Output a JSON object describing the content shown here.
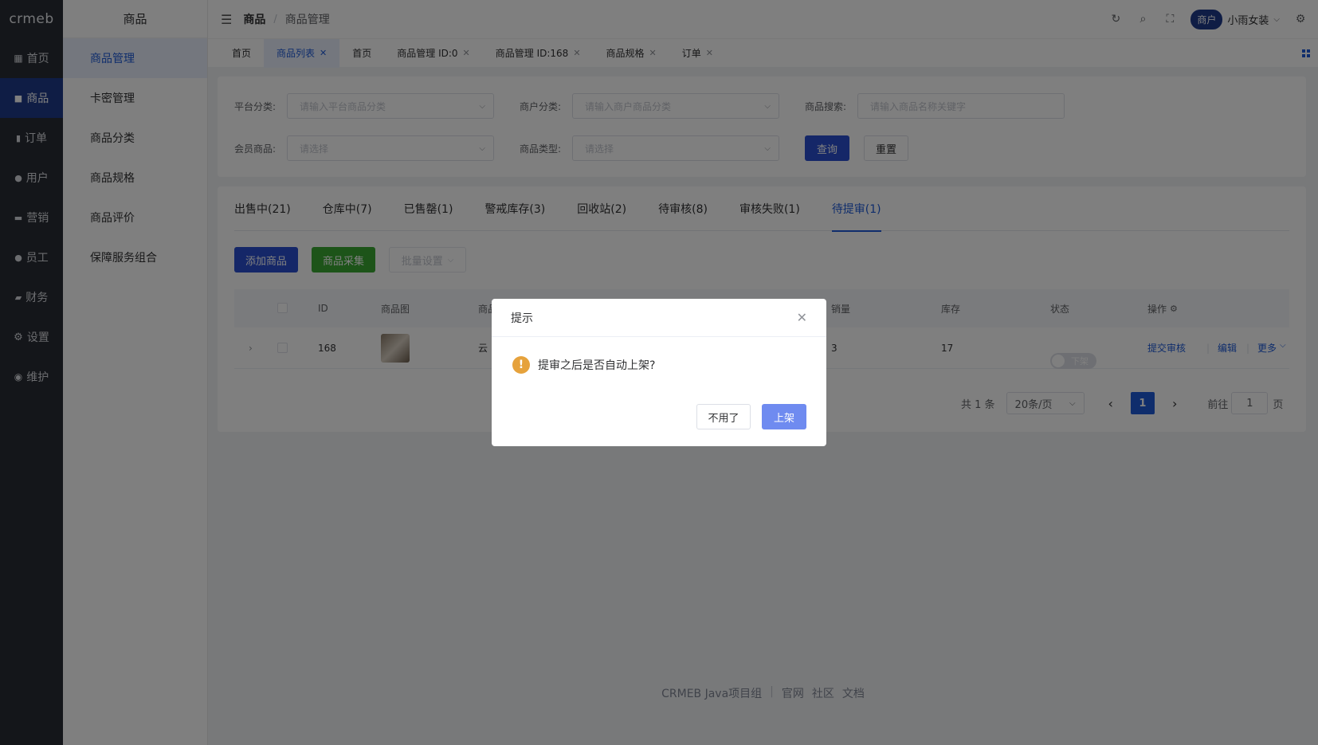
{
  "app": {
    "logo_text": "crmeb",
    "rail": [
      {
        "label": "首页",
        "icon": "grid-icon"
      },
      {
        "label": "商品",
        "icon": "bag-icon"
      },
      {
        "label": "订单",
        "icon": "clipboard-icon"
      },
      {
        "label": "用户",
        "icon": "user-icon"
      },
      {
        "label": "营销",
        "icon": "tag-icon"
      },
      {
        "label": "员工",
        "icon": "staff-icon"
      },
      {
        "label": "财务",
        "icon": "wallet-icon"
      },
      {
        "label": "设置",
        "icon": "gear-icon"
      },
      {
        "label": "维护",
        "icon": "wrench-icon"
      }
    ],
    "active_rail": "商品"
  },
  "sub_sidebar": {
    "title": "商品",
    "items": [
      "商品管理",
      "卡密管理",
      "商品分类",
      "商品规格",
      "商品评价",
      "保障服务组合"
    ],
    "active": "商品管理"
  },
  "header": {
    "breadcrumb_main": "商品",
    "breadcrumb_sub": "商品管理",
    "merchant_label": "商户",
    "user_name": "小雨女装"
  },
  "tabs": [
    {
      "label": "首页",
      "closable": false
    },
    {
      "label": "商品列表",
      "closable": true,
      "active": true
    },
    {
      "label": "首页",
      "closable": false
    },
    {
      "label": "商品管理 ID:0",
      "closable": true
    },
    {
      "label": "商品管理 ID:168",
      "closable": true
    },
    {
      "label": "商品规格",
      "closable": true
    },
    {
      "label": "订单",
      "closable": true
    }
  ],
  "filters": {
    "platform_category_label": "平台分类:",
    "platform_category_placeholder": "请输入平台商品分类",
    "merchant_category_label": "商户分类:",
    "merchant_category_placeholder": "请输入商户商品分类",
    "search_label": "商品搜索:",
    "search_placeholder": "请输入商品名称关键字",
    "member_label": "会员商品:",
    "member_placeholder": "请选择",
    "type_label": "商品类型:",
    "type_placeholder": "请选择",
    "query_button": "查询",
    "reset_button": "重置"
  },
  "status_tabs": [
    "出售中(21)",
    "仓库中(7)",
    "已售罄(1)",
    "警戒库存(3)",
    "回收站(2)",
    "待审核(8)",
    "审核失败(1)",
    "待提审(1)"
  ],
  "active_status_tab": "待提审(1)",
  "actions": {
    "add": "添加商品",
    "collect": "商品采集",
    "batch": "批量设置"
  },
  "table": {
    "headers": {
      "id": "ID",
      "image": "商品图",
      "name": "商品",
      "sales": "销量",
      "stock": "库存",
      "status": "状态",
      "ops": "操作"
    },
    "rows": [
      {
        "id": "168",
        "name": "云",
        "sales": "3",
        "stock": "17",
        "status": "下架",
        "op_submit": "提交审核",
        "op_edit": "编辑",
        "op_more": "更多"
      }
    ]
  },
  "pagination": {
    "total": "共 1 条",
    "page_size": "20条/页",
    "current": "1",
    "goto_label": "前往",
    "goto_value": "1",
    "page_suffix": "页"
  },
  "footer": {
    "org": "CRMEB Java项目组",
    "links": [
      "官网",
      "社区",
      "文档"
    ]
  },
  "dialog": {
    "title": "提示",
    "message": "提审之后是否自动上架?",
    "cancel": "不用了",
    "confirm": "上架"
  },
  "colors": {
    "brand": "#1e5bd8",
    "rail_bg": "#282c34",
    "warning": "#e6a23c"
  }
}
